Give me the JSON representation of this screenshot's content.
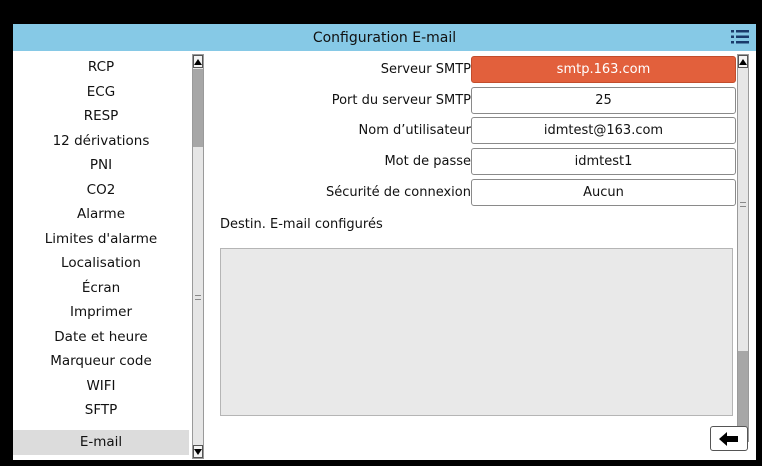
{
  "window": {
    "title": "Configuration E-mail",
    "menu_icon": "menu-list-icon"
  },
  "sidebar": {
    "items": [
      {
        "label": "RCP"
      },
      {
        "label": "ECG"
      },
      {
        "label": "RESP"
      },
      {
        "label": "12 dérivations"
      },
      {
        "label": "PNI"
      },
      {
        "label": "CO2"
      },
      {
        "label": "Alarme"
      },
      {
        "label": "Limites d'alarme"
      },
      {
        "label": "Localisation"
      },
      {
        "label": "Écran"
      },
      {
        "label": "Imprimer"
      },
      {
        "label": "Date et heure"
      },
      {
        "label": "Marqueur code"
      },
      {
        "label": "WIFI"
      },
      {
        "label": "SFTP"
      },
      {
        "label": "E-mail",
        "active": true
      }
    ]
  },
  "form": {
    "smtp_server": {
      "label": "Serveur SMTP",
      "value": "smtp.163.com",
      "selected": true
    },
    "smtp_port": {
      "label": "Port du serveur SMTP",
      "value": "25"
    },
    "username": {
      "label": "Nom d’utilisateur",
      "value": "idmtest@163.com"
    },
    "password": {
      "label": "Mot de passe",
      "value": "idmtest1"
    },
    "security": {
      "label": "Sécurité de connexion",
      "value": "Aucun"
    }
  },
  "recipients": {
    "label": "Destin. E-mail configurés",
    "items": []
  },
  "footer": {
    "back_icon": "arrow-left-icon"
  },
  "colors": {
    "titlebar": "#86c9e6",
    "selected_field": "#e2603c",
    "active_sidebar": "#dcdcdc"
  }
}
